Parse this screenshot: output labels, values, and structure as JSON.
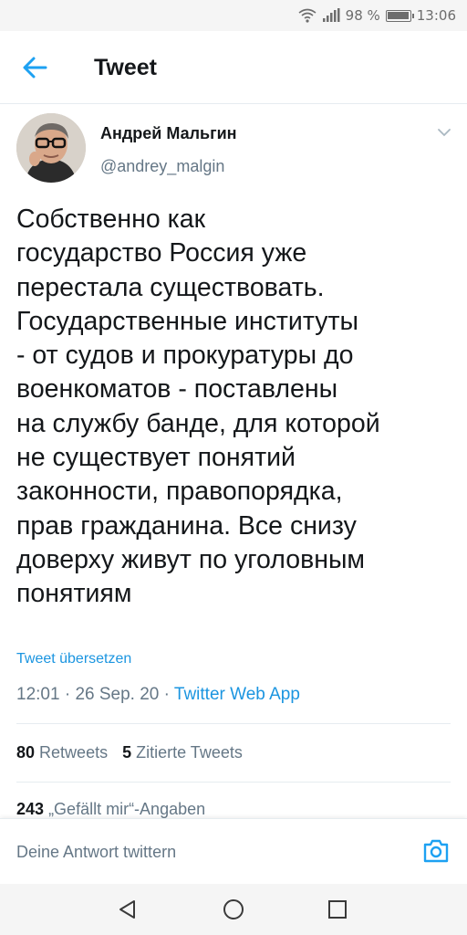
{
  "status_bar": {
    "battery": "98 %",
    "time": "13:06"
  },
  "header": {
    "title": "Tweet"
  },
  "author": {
    "name": "Андрей Мальгин",
    "handle": "@andrey_malgin"
  },
  "tweet": {
    "text": "Собственно как\nгосударство Россия уже\nперестала существовать.\nГосударственные институты\n- от судов и прокуратуры до\nвоенкоматов - поставлены\nна службу банде, для которой\nне существует понятий\nзаконности, правопорядка,\nправ гражданина. Все снизу\nдоверху живут по уголовным\nпонятиям",
    "translate_label": "Tweet übersetzen",
    "time": "12:01",
    "date": "26 Sep. 20",
    "source": "Twitter Web App",
    "separator": " · "
  },
  "stats": {
    "retweets_count": "80",
    "retweets_label": "Retweets",
    "quotes_count": "5",
    "quotes_label": "Zitierte Tweets",
    "likes_count": "243",
    "likes_label": "„Gefällt mir“-Angaben"
  },
  "reply": {
    "placeholder": "Deine Antwort twittern"
  },
  "colors": {
    "accent": "#1b95e0",
    "text": "#14171a",
    "secondary": "#657786"
  },
  "icons": [
    "wifi-icon",
    "signal-icon",
    "battery-icon",
    "back-arrow-icon",
    "chevron-down-icon",
    "camera-icon",
    "nav-back-icon",
    "nav-home-icon",
    "nav-recent-icon"
  ]
}
